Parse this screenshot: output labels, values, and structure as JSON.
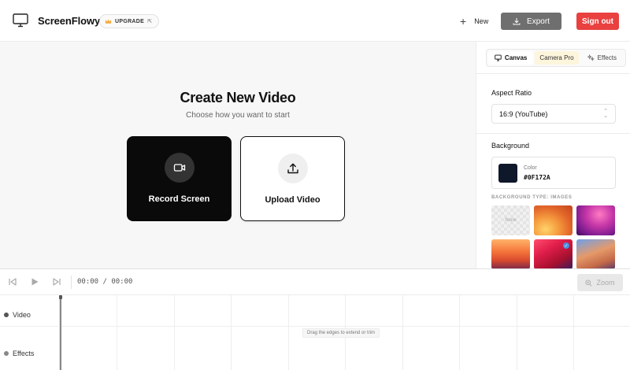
{
  "header": {
    "brand": "ScreenFlowy",
    "upgrade_label": "UPGRADE",
    "new_label": "New",
    "export_label": "Export",
    "signout_label": "Sign out"
  },
  "main": {
    "title": "Create New Video",
    "subtitle": "Choose how you want to start",
    "cards": [
      {
        "label": "Record Screen",
        "icon": "camera-icon"
      },
      {
        "label": "Upload Video",
        "icon": "upload-icon"
      }
    ]
  },
  "sidebar": {
    "tabs": [
      {
        "label": "Canvas",
        "icon": "monitor-icon",
        "active": true
      },
      {
        "label": "Camera Pro",
        "icon": null,
        "active": false
      },
      {
        "label": "Effects",
        "icon": "sparkles-icon",
        "active": false
      }
    ],
    "aspect_ratio_label": "Aspect Ratio",
    "aspect_ratio_value": "16:9 (YouTube)",
    "background_label": "Background",
    "color_caption": "Color",
    "color_hex": "#0F172A",
    "background_type_label": "BACKGROUND TYPE: IMAGES",
    "none_label": "None"
  },
  "timeline": {
    "timecode": "00:00 / 00:00",
    "zoom_label": "Zoom",
    "tracks": [
      {
        "label": "Video"
      },
      {
        "label": "Effects"
      }
    ],
    "hint": "Drag the edges to extend or trim"
  },
  "colors": {
    "accent_red": "#E94040",
    "export_gray": "#6F6F6F",
    "swatch": "#0F172A",
    "camera_tab_bg": "#FDF5DC"
  }
}
